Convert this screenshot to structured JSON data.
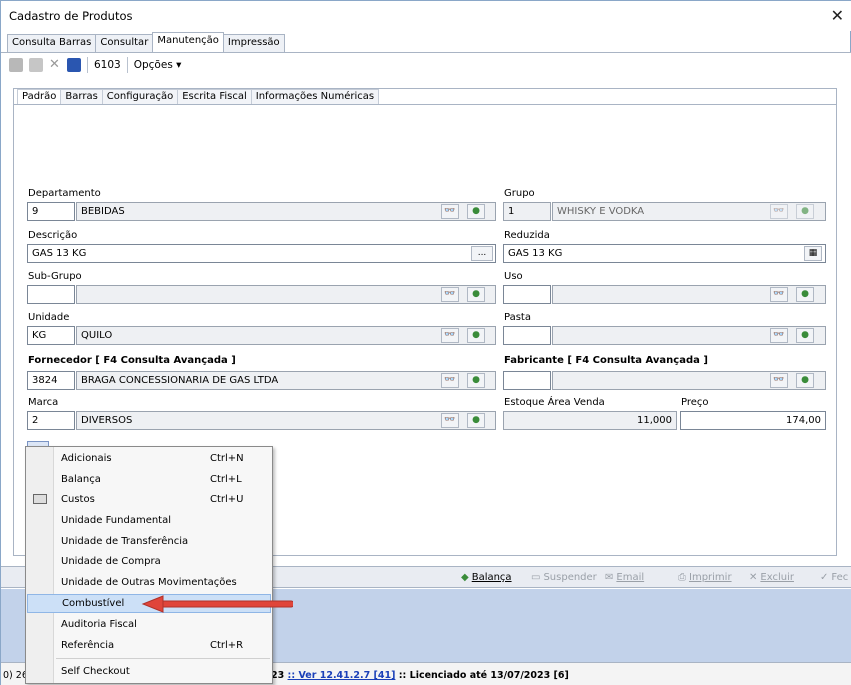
{
  "window": {
    "title": "Cadastro de Produtos",
    "close": "✕"
  },
  "outer_tabs": [
    "Consulta Barras",
    "Consultar",
    "Manutenção",
    "Impressão"
  ],
  "toolbar": {
    "code": "6103",
    "options": "Opções ▾"
  },
  "inner_tabs": [
    "Padrão",
    "Barras",
    "Configuração",
    "Escrita Fiscal",
    "Informações Numéricas"
  ],
  "form": {
    "departamento": {
      "label": "Departamento",
      "code": "9",
      "name": "BEBIDAS"
    },
    "grupo": {
      "label": "Grupo",
      "code": "1",
      "name": "WHISKY E VODKA"
    },
    "descricao": {
      "label": "Descrição",
      "value": "GAS 13 KG",
      "btn": "..."
    },
    "reduzida": {
      "label": "Reduzida",
      "value": "GAS 13 KG"
    },
    "subgrupo": {
      "label": "Sub-Grupo",
      "code": "",
      "name": ""
    },
    "uso": {
      "label": "Uso",
      "code": "",
      "name": ""
    },
    "unidade": {
      "label": "Unidade",
      "code": "KG",
      "name": "QUILO"
    },
    "pasta": {
      "label": "Pasta",
      "code": "",
      "name": ""
    },
    "fornecedor": {
      "label": "Fornecedor [ F4 Consulta Avançada ]",
      "code": "3824",
      "name": "BRAGA CONCESSIONARIA DE GAS LTDA"
    },
    "fabricante": {
      "label": "Fabricante [ F4 Consulta Avançada ]",
      "code": "",
      "name": ""
    },
    "marca": {
      "label": "Marca",
      "code": "2",
      "name": "DIVERSOS"
    },
    "estoque": {
      "label": "Estoque Área Venda",
      "value": "11,000"
    },
    "preco": {
      "label": "Preço",
      "value": "174,00"
    }
  },
  "bottom_buttons": {
    "balanca": "Balança",
    "suspender": "Suspender",
    "email": "Email",
    "imprimir": "Imprimir",
    "excluir": "Excluir",
    "fechar": "Fec"
  },
  "context_menu": [
    {
      "label": "Adicionais",
      "shortcut": "Ctrl+N"
    },
    {
      "label": "Balança",
      "shortcut": "Ctrl+L"
    },
    {
      "label": "Custos",
      "shortcut": "Ctrl+U"
    },
    {
      "label": "Unidade Fundamental",
      "shortcut": ""
    },
    {
      "label": "Unidade de Transferência",
      "shortcut": ""
    },
    {
      "label": "Unidade de Compra",
      "shortcut": ""
    },
    {
      "label": "Unidade de Outras Movimentações",
      "shortcut": ""
    },
    {
      "label": "Combustível",
      "shortcut": ""
    },
    {
      "label": "Auditoria Fiscal",
      "shortcut": ""
    },
    {
      "label": "Referência",
      "shortcut": "Ctrl+R"
    },
    {
      "label": "Self Checkout",
      "shortcut": ""
    }
  ],
  "status": {
    "left": "0) 26",
    "mid": "23",
    "version": ":: Ver 12.41.2.7 [41]",
    "license": ":: Licenciado até 13/07/2023 [6]"
  },
  "colors": {
    "accent": "#1a3fb8",
    "highlight": "#cce0f7",
    "arrow": "#e0453a"
  }
}
